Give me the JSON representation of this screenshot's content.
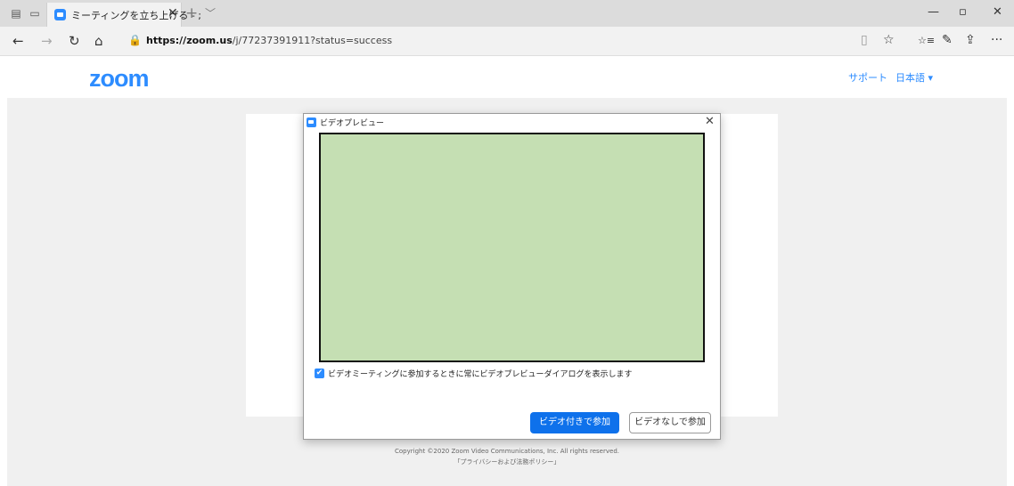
{
  "browser": {
    "tab_title": "ミーティングを立ち上げる - ;",
    "tab_close": "✕",
    "new_tab": "+",
    "tab_menu": "﹀",
    "window_controls": {
      "minimize": "—",
      "restore": "▫",
      "close": "✕"
    },
    "nav": {
      "back": "←",
      "forward": "→",
      "refresh": "↻",
      "home": "⌂"
    },
    "url_host": "https://zoom.us",
    "url_path": "/j/77237391911?status=success",
    "tools": {
      "reading_view": "▯",
      "favorite": "☆",
      "favorites_hub": "☆≡",
      "notes": "✎",
      "share": "⇪",
      "more": "···"
    }
  },
  "header": {
    "logo": "zoom",
    "support": "サポート",
    "language": "日本語 ▾"
  },
  "dialog": {
    "title": "ビデオプレビュー",
    "close": "✕",
    "checkbox_checked": true,
    "checkbox_label": "ビデオミーティングに参加するときに常にビデオプレビューダイアログを表示します",
    "join_with_video": "ビデオ付きで参加",
    "join_without_video": "ビデオなしで参加",
    "preview_color": "#c5dfb3"
  },
  "footer": {
    "copyright": "Copyright ©2020 Zoom Video Communications, Inc. All rights reserved.",
    "privacy": "「プライバシーおよび法務ポリシー」"
  },
  "colors": {
    "accent": "#2d8cff",
    "button": "#0e71eb"
  }
}
